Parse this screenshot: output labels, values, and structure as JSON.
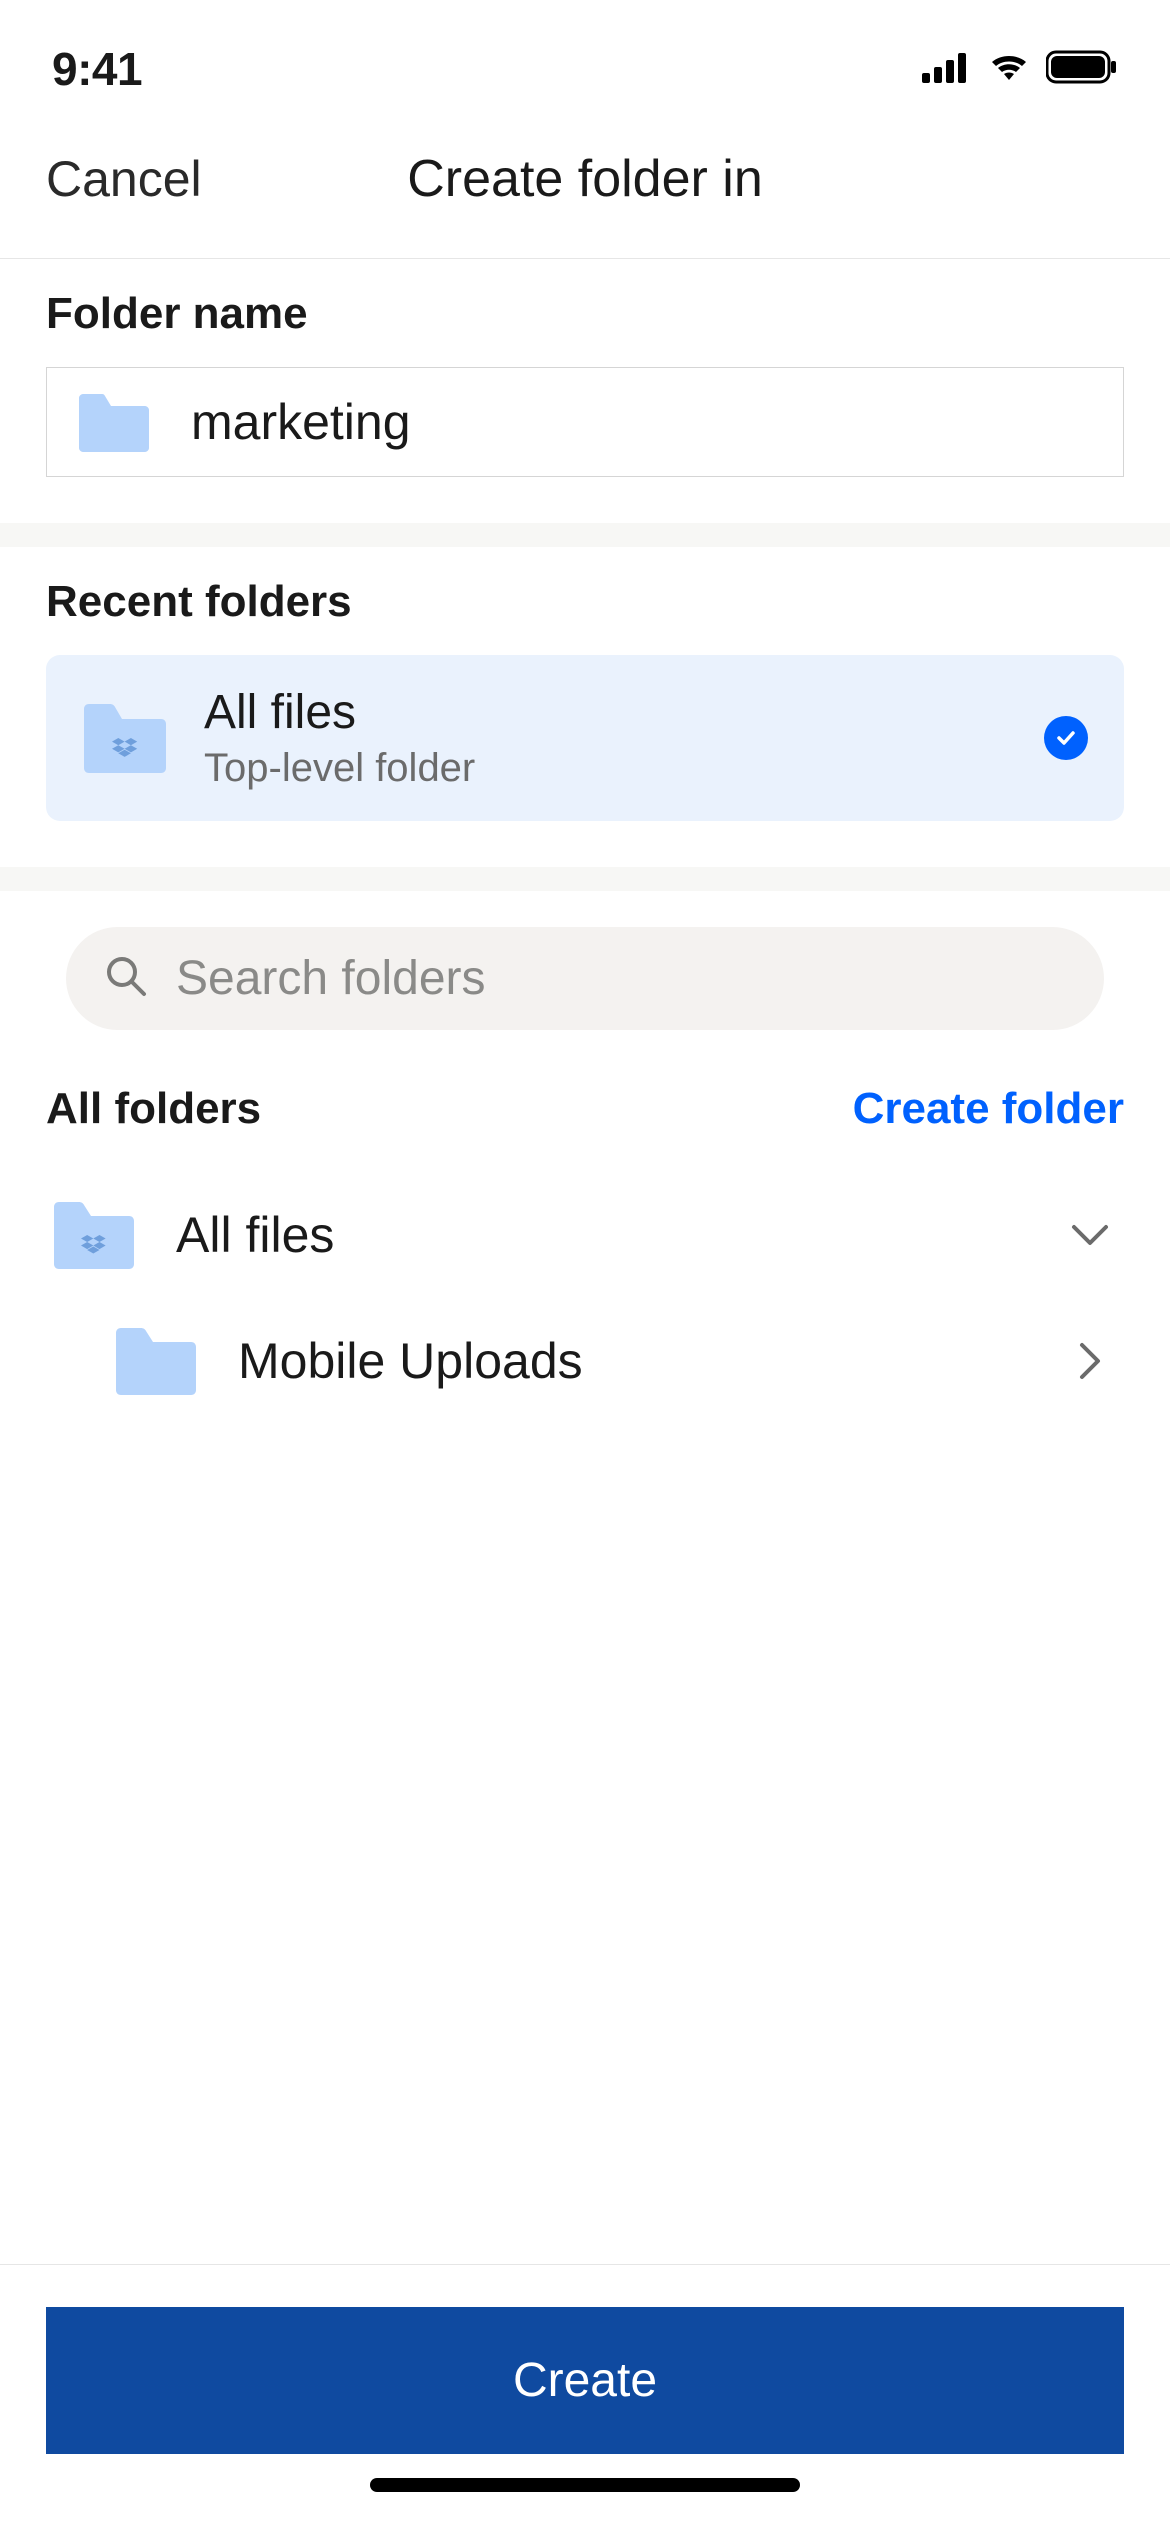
{
  "status": {
    "time": "9:41"
  },
  "nav": {
    "cancel": "Cancel",
    "title": "Create folder in"
  },
  "folder_name": {
    "label": "Folder name",
    "value": "marketing"
  },
  "recent": {
    "label": "Recent folders",
    "item": {
      "title": "All files",
      "subtitle": "Top-level folder",
      "selected": true
    }
  },
  "search": {
    "placeholder": "Search folders"
  },
  "all_folders": {
    "label": "All folders",
    "create_link": "Create folder",
    "tree": [
      {
        "label": "All files",
        "kind": "dropbox",
        "expanded": true
      },
      {
        "label": "Mobile Uploads",
        "kind": "plain",
        "child": true
      }
    ]
  },
  "cta": {
    "create": "Create"
  },
  "colors": {
    "folder_light": "#b4d3fb",
    "accent": "#0061fe",
    "cta": "#0f4aa0"
  }
}
